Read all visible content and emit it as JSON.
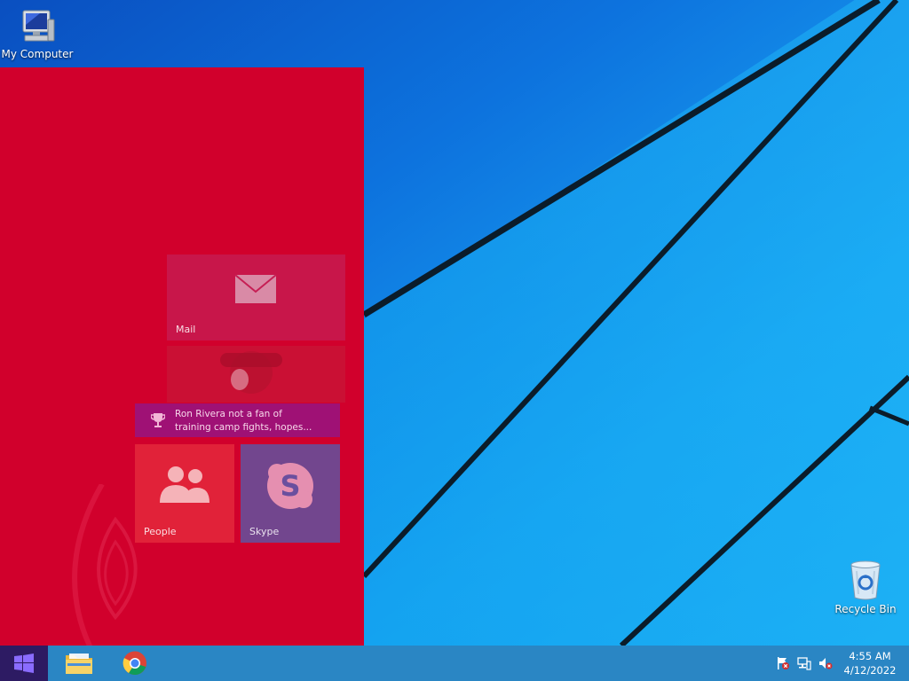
{
  "desktop": {
    "icons": [
      {
        "label": "My Computer",
        "icon": "computer-icon"
      },
      {
        "label": "Recycle Bin",
        "icon": "recycle-bin-icon"
      }
    ]
  },
  "start_panel": {
    "accent_color": "#d1002c",
    "tiles": {
      "mail": {
        "label": "Mail",
        "icon": "mail-icon"
      },
      "news": {
        "headline_line1": "Ron Rivera not a fan of",
        "headline_line2": "training camp fights, hopes...",
        "icon": "trophy-icon"
      },
      "people": {
        "label": "People",
        "icon": "people-icon"
      },
      "skype": {
        "label": "Skype",
        "icon": "skype-icon"
      }
    }
  },
  "taskbar": {
    "start_icon": "windows-logo-icon",
    "pinned": [
      {
        "name": "File Explorer",
        "icon": "file-explorer-icon"
      },
      {
        "name": "Google Chrome",
        "icon": "chrome-icon"
      }
    ],
    "tray": {
      "icons": [
        "action-center-flag-icon",
        "network-icon",
        "volume-muted-icon"
      ],
      "time": "4:55 AM",
      "date": "4/12/2022"
    }
  }
}
